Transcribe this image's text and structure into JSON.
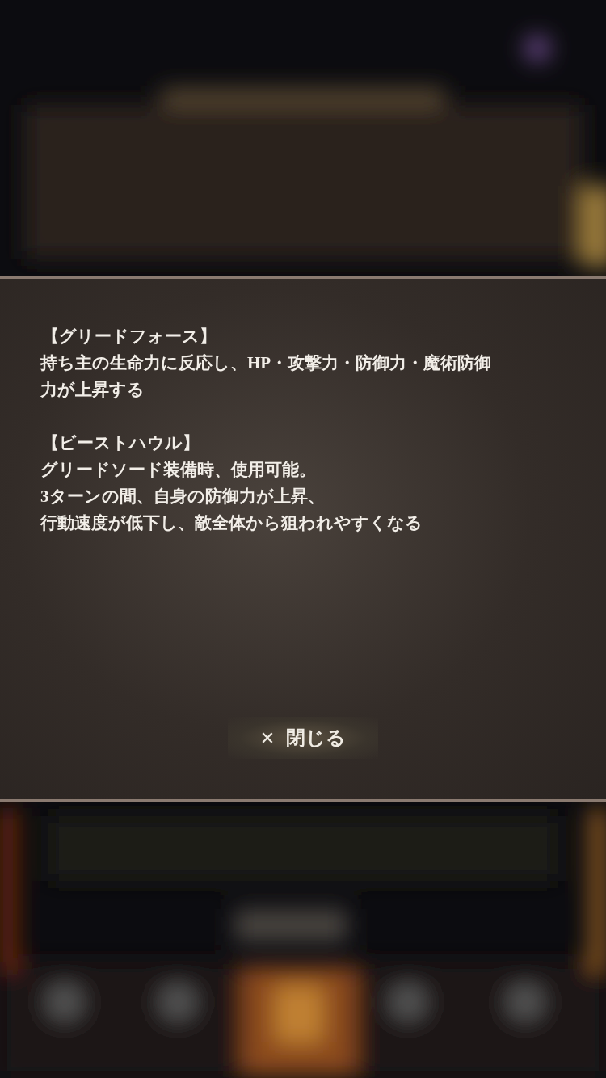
{
  "dialog": {
    "sections": [
      {
        "title": "【グリードフォース】",
        "lines": [
          "持ち主の生命力に反応し、HP・攻撃力・防御力・魔術防御",
          "力が上昇する"
        ]
      },
      {
        "title": "【ビーストハウル】",
        "lines": [
          "グリードソード装備時、使用可能。",
          "3ターンの間、自身の防御力が上昇、",
          "行動速度が低下し、敵全体から狙われやすくなる"
        ]
      }
    ],
    "close_button": {
      "icon": "✕",
      "label": "閉じる"
    }
  }
}
